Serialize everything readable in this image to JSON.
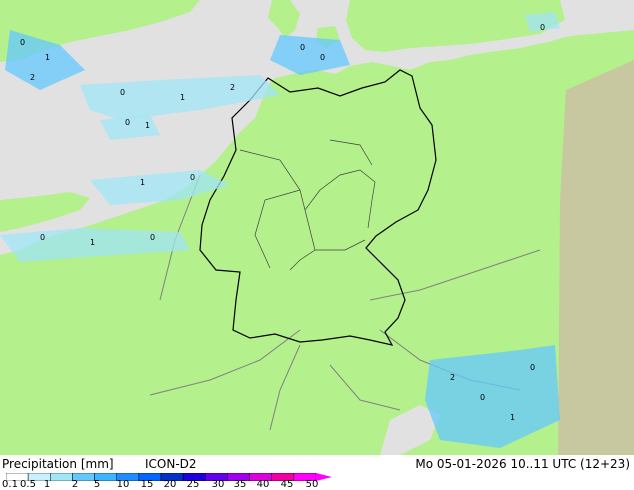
{
  "map": {
    "colors": {
      "land": "#b4f08c",
      "sea": "#e1e1e1",
      "outside_domain": "#c8c8a0",
      "border": "#808080",
      "germany_border": "#000000",
      "precip_light": "#a0e6f5",
      "precip_medium": "#64c8ff"
    },
    "precip_labels": [
      "0",
      "1",
      "2",
      "0",
      "1",
      "2",
      "0",
      "1",
      "0",
      "0",
      "1",
      "0",
      "0",
      "1",
      "0",
      "2",
      "0",
      "1",
      "0",
      "0"
    ]
  },
  "footer": {
    "title": "Precipitation [mm]",
    "model": "ICON-D2",
    "datetime": "Mo 05-01-2026 10..11 UTC (12+23)",
    "colorbar": {
      "labels": [
        "0.1",
        "0.5",
        "1",
        "2",
        "5",
        "10",
        "15",
        "20",
        "25",
        "30",
        "35",
        "40",
        "45",
        "50"
      ],
      "colors": [
        "#ffffff",
        "#c8f0ff",
        "#a0e6f5",
        "#64c8ff",
        "#3cb4ff",
        "#1e8cff",
        "#0064ff",
        "#0032c8",
        "#1e00dc",
        "#6400f0",
        "#a000f0",
        "#dc00dc",
        "#f000a0",
        "#ff00ff"
      ]
    }
  }
}
